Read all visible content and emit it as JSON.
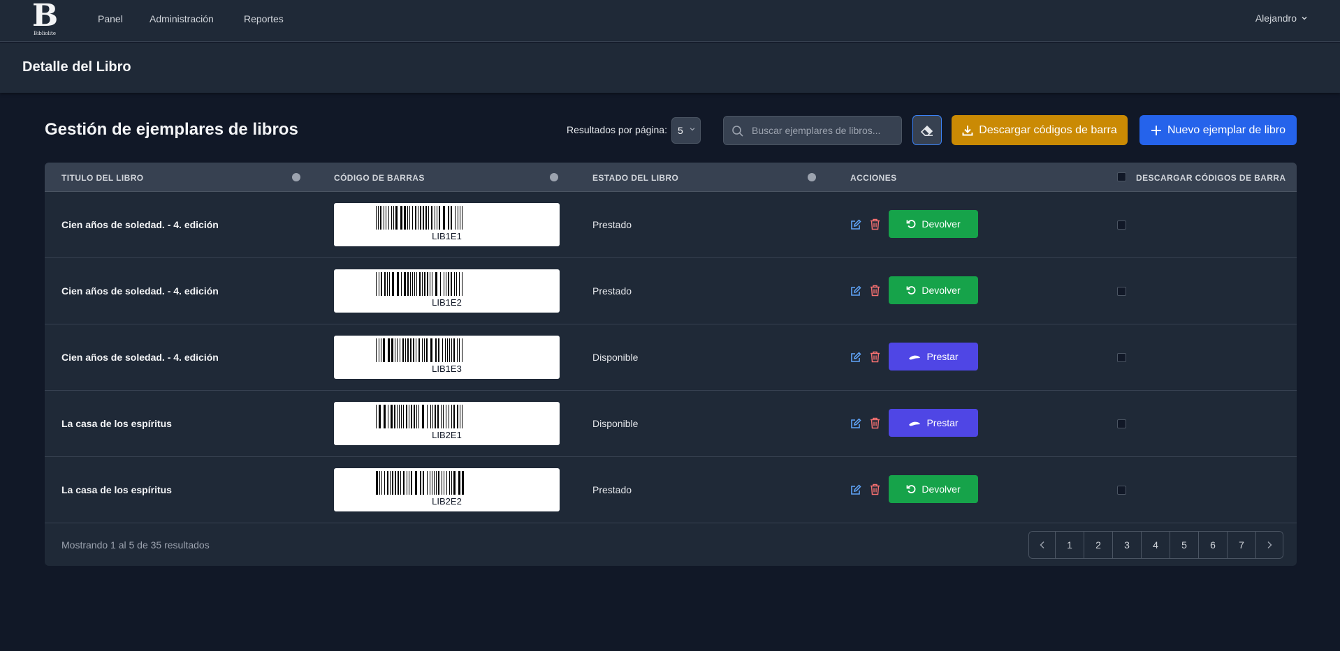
{
  "nav": {
    "logo_letter": "B",
    "logo_text": "Bibliolite",
    "links": [
      "Panel",
      "Administración",
      "Reportes"
    ],
    "user": "Alejandro"
  },
  "page": {
    "title": "Detalle del Libro"
  },
  "section": {
    "title": "Gestión de ejemplares de libros"
  },
  "toolbar": {
    "per_page_label": "Resultados por página:",
    "per_page_value": "5",
    "search_placeholder": "Buscar ejemplares de libros...",
    "download_label": "Descargar códigos de barra",
    "new_label": "Nuevo ejemplar de libro"
  },
  "table": {
    "headers": {
      "title": "TITULO DEL LIBRO",
      "barcode": "CÓDIGO DE BARRAS",
      "status": "ESTADO DEL LIBRO",
      "actions": "ACCIONES",
      "download": "DESCARGAR CÓDIGOS DE BARRA"
    },
    "rows": [
      {
        "title": "Cien años de soledad. - 4. edición",
        "code": "LIB1E1",
        "status": "Prestado",
        "action": "Devolver"
      },
      {
        "title": "Cien años de soledad. - 4. edición",
        "code": "LIB1E2",
        "status": "Prestado",
        "action": "Devolver"
      },
      {
        "title": "Cien años de soledad. - 4. edición",
        "code": "LIB1E3",
        "status": "Disponible",
        "action": "Prestar"
      },
      {
        "title": "La casa de los espíritus",
        "code": "LIB2E1",
        "status": "Disponible",
        "action": "Prestar"
      },
      {
        "title": "La casa de los espíritus",
        "code": "LIB2E2",
        "status": "Prestado",
        "action": "Devolver"
      }
    ]
  },
  "footer": {
    "summary": "Mostrando 1 al 5 de 35 resultados",
    "pages": [
      "1",
      "2",
      "3",
      "4",
      "5",
      "6",
      "7"
    ]
  },
  "colors": {
    "background": "#111827",
    "panel": "#1f2937",
    "return": "#16a34a",
    "lend": "#4f46e5",
    "download": "#ca8a04",
    "primary": "#2563eb",
    "edit_icon": "#60a5fa",
    "delete_icon": "#f87171"
  },
  "icons": {
    "search": "search-icon",
    "eraser": "eraser-icon",
    "download": "download-icon",
    "add": "plus-icon",
    "edit": "edit-icon",
    "delete": "trash-icon",
    "return": "undo-icon",
    "lend": "hand-icon"
  }
}
